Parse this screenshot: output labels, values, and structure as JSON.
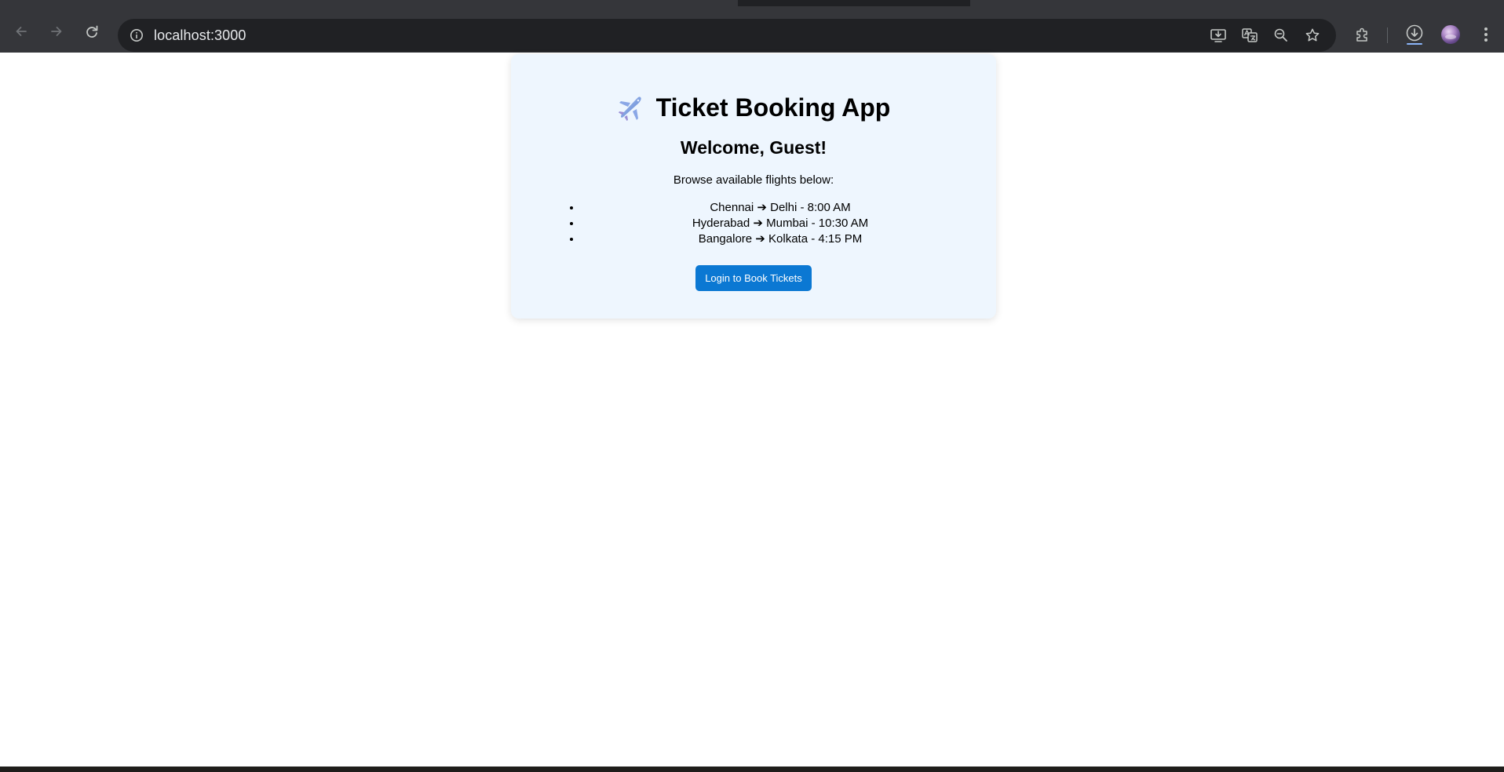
{
  "browser": {
    "url": "localhost:3000",
    "icons": {
      "back": "back-arrow-icon",
      "forward": "forward-arrow-icon",
      "reload": "reload-icon",
      "site_info": "info-icon",
      "install": "install-app-icon",
      "translate": "translate-icon",
      "zoom": "zoom-out-icon",
      "bookmark": "star-icon",
      "extensions": "puzzle-icon",
      "downloads": "download-icon",
      "profile": "avatar",
      "menu": "kebab-menu-icon"
    },
    "colors": {
      "frame": "#202124",
      "toolbar": "#35363a",
      "omnibox": "#202124",
      "icon": "#c4c7c5"
    }
  },
  "page": {
    "card": {
      "title_icon": "airplane-icon",
      "title": "Ticket Booking App",
      "welcome": "Welcome, Guest!",
      "subtitle": "Browse available flights below:",
      "flights": [
        "Chennai ➔ Delhi - 8:00 AM",
        "Hyderabad ➔ Mumbai - 10:30 AM",
        "Bangalore ➔ Kolkata - 4:15 PM"
      ],
      "login_button": "Login to Book Tickets"
    },
    "colors": {
      "card_background": "#eef6fe",
      "button_background": "#0b78d3",
      "button_text": "#ffffff"
    }
  }
}
